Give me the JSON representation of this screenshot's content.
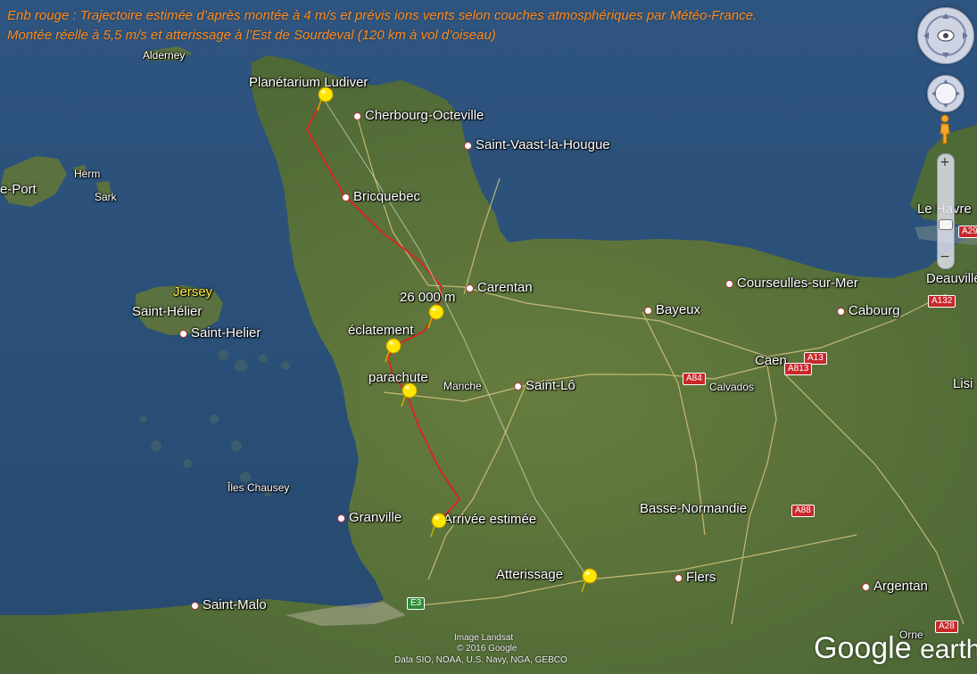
{
  "caption": {
    "line1": "Enb rouge : Trajectoire estimée d’après montée à 4 m/s et prévis ions vents selon couches atmosphériques par Météo-France.",
    "line2": "Montée réelle à 5,5 m/s et atterissage à l’Est de Sourdeval (120 km à vol d’oiseau)"
  },
  "markers": {
    "ludiver": "Planétarium Ludiver",
    "altitude": "26 000 m",
    "burst": "éclatement",
    "parachute": "parachute",
    "estimated_arrival": "Arrivée estimée",
    "landing": "Atterissage"
  },
  "places": {
    "alderney": "Alderney",
    "cherbourg": "Cherbourg-Octeville",
    "saint_vaast": "Saint-Vaast-la-Hougue",
    "herm": "Herm",
    "port": "e-Port",
    "sark": "Sark",
    "bricquebec": "Bricquebec",
    "jersey": "Jersey",
    "saint_helier_1": "Saint-Hélier",
    "saint_helier_2": "Saint-Helier",
    "carentan": "Carentan",
    "courseulles": "Courseulles-sur-Mer",
    "deauville": "Deauville",
    "le_havre": "Le Havre",
    "bayeux": "Bayeux",
    "cabourg": "Cabourg",
    "caen": "Caen",
    "calvados": "Calvados",
    "manche": "Manche",
    "saint_lo": "Saint-Lô",
    "lisieux": "Lisi",
    "chausey": "Îles Chausey",
    "granville": "Granville",
    "basse_normandie": "Basse-Normandie",
    "flers": "Flers",
    "argentan": "Argentan",
    "saint_malo": "Saint-Malo",
    "orne": "Orne"
  },
  "roads": {
    "a29": "A29",
    "a132": "A132",
    "a13_1": "A13",
    "a813": "A813",
    "a84": "A84",
    "a88": "A88",
    "a28": "A28",
    "e3": "E3"
  },
  "credits": {
    "image": "Image Landsat",
    "copyright": "© 2016 Google",
    "data": "Data SIO, NOAA, U.S. Navy, NGA, GEBCO",
    "logo_google": "Google",
    "logo_earth": "earth"
  },
  "colors": {
    "trajectory": "#e0221f",
    "caption": "#ff8a1c",
    "sea": "#2a4d73",
    "land": "#55703a",
    "pin": "#ffe600"
  }
}
